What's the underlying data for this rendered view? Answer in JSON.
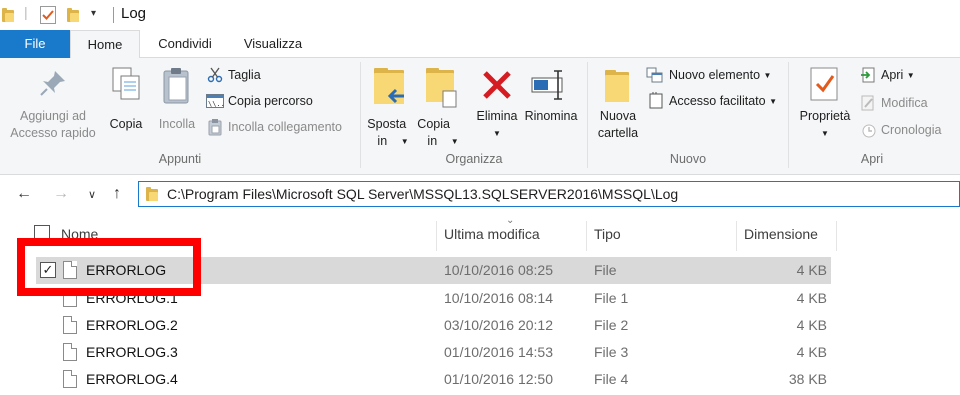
{
  "window": {
    "title": "Log"
  },
  "ribbon_tabs": {
    "file": "File",
    "home": "Home",
    "share": "Condividi",
    "view": "Visualizza"
  },
  "ribbon": {
    "appunti": {
      "label": "Appunti",
      "pin": "Aggiungi ad Accesso rapido",
      "copy": "Copia",
      "paste": "Incolla",
      "cut": "Taglia",
      "copy_path": "Copia percorso",
      "paste_shortcut": "Incolla collegamento"
    },
    "organizza": {
      "label": "Organizza",
      "move_to": "Sposta in",
      "copy_to": "Copia in",
      "delete": "Elimina",
      "rename": "Rinomina"
    },
    "nuovo": {
      "label": "Nuovo",
      "new_folder": "Nuova cartella",
      "new_item": "Nuovo elemento",
      "easy_access": "Accesso facilitato"
    },
    "apri": {
      "label": "Apri",
      "properties": "Proprietà",
      "open": "Apri",
      "edit": "Modifica",
      "history": "Cronologia"
    }
  },
  "address": {
    "path": "C:\\Program Files\\Microsoft SQL Server\\MSSQL13.SQLSERVER2016\\MSSQL\\Log"
  },
  "columns": {
    "name": "Nome",
    "modified": "Ultima modifica",
    "type": "Tipo",
    "size": "Dimensione"
  },
  "files": [
    {
      "name": "ERRORLOG",
      "modified": "10/10/2016 08:25",
      "type": "File",
      "size": "4 KB",
      "checked": true
    },
    {
      "name": "ERRORLOG.1",
      "modified": "10/10/2016 08:14",
      "type": "File 1",
      "size": "4 KB",
      "checked": false
    },
    {
      "name": "ERRORLOG.2",
      "modified": "03/10/2016 20:12",
      "type": "File 2",
      "size": "4 KB",
      "checked": false
    },
    {
      "name": "ERRORLOG.3",
      "modified": "01/10/2016 14:53",
      "type": "File 3",
      "size": "4 KB",
      "checked": false
    },
    {
      "name": "ERRORLOG.4",
      "modified": "01/10/2016 12:50",
      "type": "File 4",
      "size": "38 KB",
      "checked": false
    }
  ],
  "colors": {
    "accent": "#1979ca",
    "highlight_box": "#ff0000",
    "selected_row": "#d9d9d9"
  },
  "icons": [
    "folder-icon",
    "properties-icon",
    "dropdown-icon",
    "pin-icon",
    "copy-icon",
    "paste-icon",
    "scissors-icon",
    "copy-path-icon",
    "paste-shortcut-icon",
    "move-to-icon",
    "copy-to-icon",
    "delete-icon",
    "rename-icon",
    "new-item-icon",
    "easy-access-icon",
    "open-icon",
    "edit-icon",
    "history-icon",
    "back-icon",
    "forward-icon",
    "recent-icon",
    "up-icon",
    "file-icon",
    "checkbox-icon"
  ]
}
